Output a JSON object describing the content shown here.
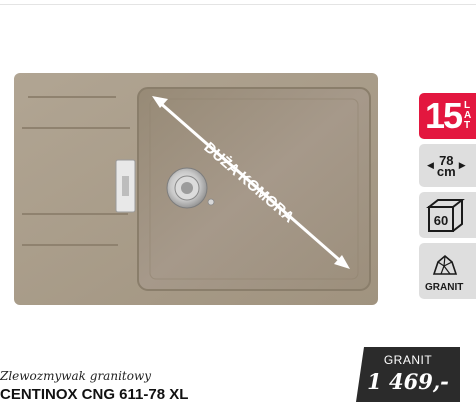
{
  "product": {
    "annotation": "DUŻA KOMORA",
    "caption_type": "Zlewozmywak granitowy",
    "caption_name": "CENTINOX CNG 611-78 XL"
  },
  "badges": {
    "warranty_number": "15",
    "warranty_lines": [
      "L",
      "A",
      "T"
    ],
    "width_value": "78",
    "width_unit": "cm",
    "cabinet_value": "60",
    "material_label": "GRANIT"
  },
  "price": {
    "material": "GRANIT",
    "value": "1 469,-"
  },
  "colors": {
    "warranty_red": "#e3173f",
    "badge_grey": "#dedede",
    "price_bg": "#2b2b2b",
    "sink_granite": "#a89b8a"
  },
  "icons": [
    "width-arrows-icon",
    "cabinet-box-icon",
    "granite-stone-icon",
    "drain-icon",
    "overflow-icon"
  ]
}
